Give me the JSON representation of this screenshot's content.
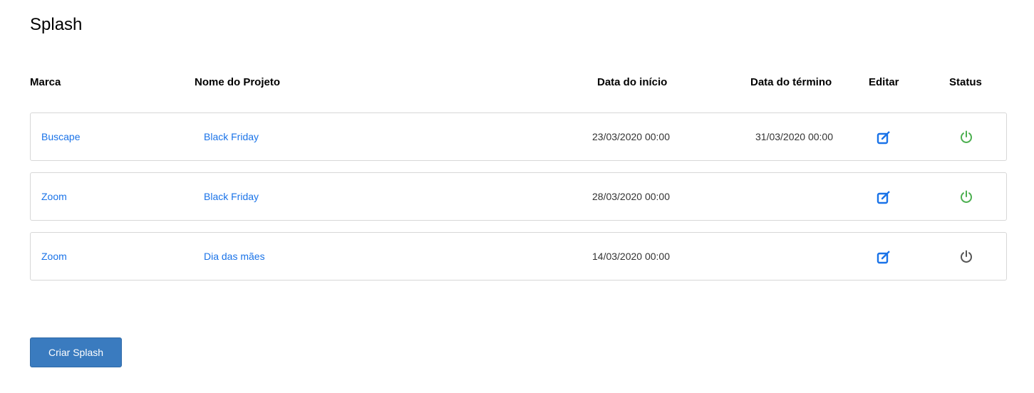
{
  "page": {
    "title": "Splash"
  },
  "table": {
    "headers": {
      "marca": "Marca",
      "nome": "Nome do Projeto",
      "inicio": "Data do início",
      "termino": "Data do término",
      "editar": "Editar",
      "status": "Status"
    },
    "rows": [
      {
        "marca": "Buscape",
        "nome": "Black Friday",
        "inicio": "23/03/2020 00:00",
        "termino": "31/03/2020 00:00",
        "status": "active"
      },
      {
        "marca": "Zoom",
        "nome": "Black Friday",
        "inicio": "28/03/2020 00:00",
        "termino": "",
        "status": "active"
      },
      {
        "marca": "Zoom",
        "nome": "Dia das mães",
        "inicio": "14/03/2020 00:00",
        "termino": "",
        "status": "inactive"
      }
    ]
  },
  "actions": {
    "create_label": "Criar Splash"
  },
  "colors": {
    "link": "#1a73e8",
    "status_active": "#4caf50",
    "status_inactive": "#555555",
    "edit_icon": "#1a73e8",
    "button": "#3a7bbf"
  },
  "icons": {
    "edit": "edit-icon",
    "status": "power-icon"
  }
}
